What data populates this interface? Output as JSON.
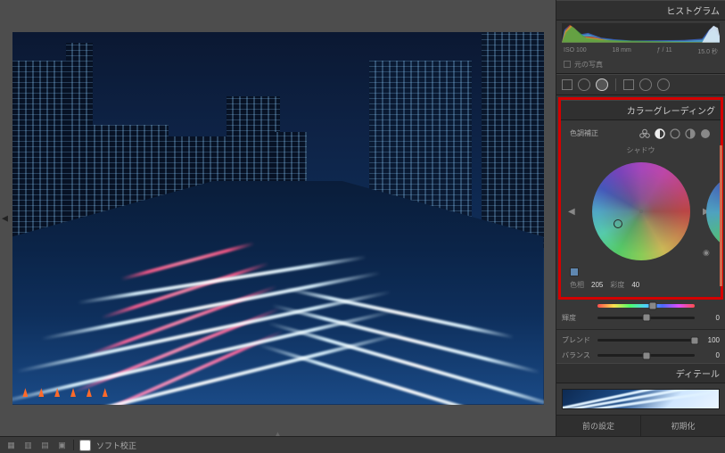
{
  "sidebar": {
    "histogram": {
      "title": "ヒストグラム",
      "meta": {
        "iso": "ISO 100",
        "focal": "18 mm",
        "aperture": "ƒ / 11",
        "shutter": "15.0 秒"
      },
      "checkbox_label": "元の写真"
    },
    "color_grading": {
      "title": "カラーグレーディング",
      "adjust_label": "色調補正",
      "subtab": "シャドウ",
      "hue_label": "色相",
      "hue_value": "205",
      "sat_label": "彩度",
      "sat_value": "40",
      "luminance": {
        "label": "輝度",
        "value": "0",
        "pos": 50
      },
      "blend": {
        "label": "ブレンド",
        "value": "100",
        "pos": 100
      },
      "balance": {
        "label": "バランス",
        "value": "0",
        "pos": 50
      }
    },
    "detail": {
      "title": "ディテール"
    },
    "footer": {
      "prev": "前の設定",
      "reset": "初期化"
    }
  },
  "toolbar": {
    "soft_proof": "ソフト校正"
  },
  "chart_data": {
    "type": "histogram",
    "title": "ヒストグラム",
    "x_range": [
      0,
      255
    ],
    "channels": [
      "red",
      "yellow",
      "green",
      "cyan",
      "blue",
      "white"
    ],
    "note": "Strong concentration in shadows (left third) with a sharp blue/white spike near highlights (right edge). Midtones relatively low.",
    "peaks": {
      "shadows": {
        "approx_bin": 20,
        "relative_height": 0.95
      },
      "midtones": {
        "approx_bin": 128,
        "relative_height": 0.15
      },
      "highlights": {
        "approx_bin": 248,
        "relative_height": 0.85
      }
    }
  }
}
